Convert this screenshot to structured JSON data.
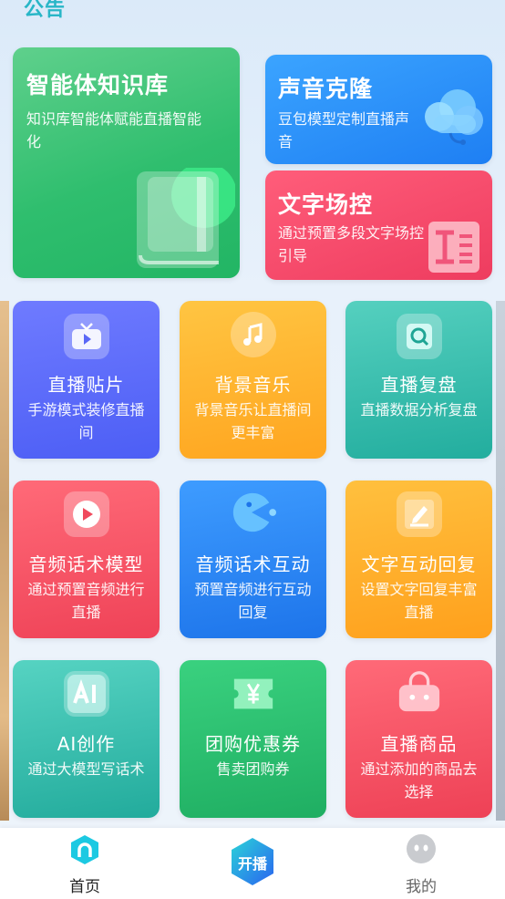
{
  "top_label": "公告",
  "feature_cards": [
    {
      "title": "智能体知识库",
      "desc": "知识库智能体赋能直播智能化",
      "icon": "book-icon"
    },
    {
      "title": "声音克隆",
      "desc": "豆包模型定制直播声音",
      "icon": "headset-cloud-icon"
    },
    {
      "title": "文字场控",
      "desc": "通过预置多段文字场控引导",
      "icon": "text-format-icon"
    }
  ],
  "tiles": [
    {
      "title": "直播贴片",
      "desc": "手游模式装修直播间",
      "icon": "tv-play-icon"
    },
    {
      "title": "背景音乐",
      "desc": "背景音乐让直播间更丰富",
      "icon": "music-note-icon"
    },
    {
      "title": "直播复盘",
      "desc": "直播数据分析复盘",
      "icon": "magnifier-icon"
    },
    {
      "title": "音频话术模型",
      "desc": "通过预置音频进行直播",
      "icon": "play-circle-icon"
    },
    {
      "title": "音频话术互动",
      "desc": "预置音频进行互动回复",
      "icon": "pacman-icon"
    },
    {
      "title": "文字互动回复",
      "desc": "设置文字回复丰富直播",
      "icon": "pen-icon"
    },
    {
      "title": "AI创作",
      "desc": "通过大模型写话术",
      "icon": "ai-icon"
    },
    {
      "title": "团购优惠券",
      "desc": "售卖团购券",
      "icon": "coupon-icon"
    },
    {
      "title": "直播商品",
      "desc": "通过添加的商品去选择",
      "icon": "shopping-bag-icon"
    }
  ],
  "bottom_nav": {
    "home_label": "首页",
    "live_label": "开播",
    "mine_label": "我的"
  }
}
